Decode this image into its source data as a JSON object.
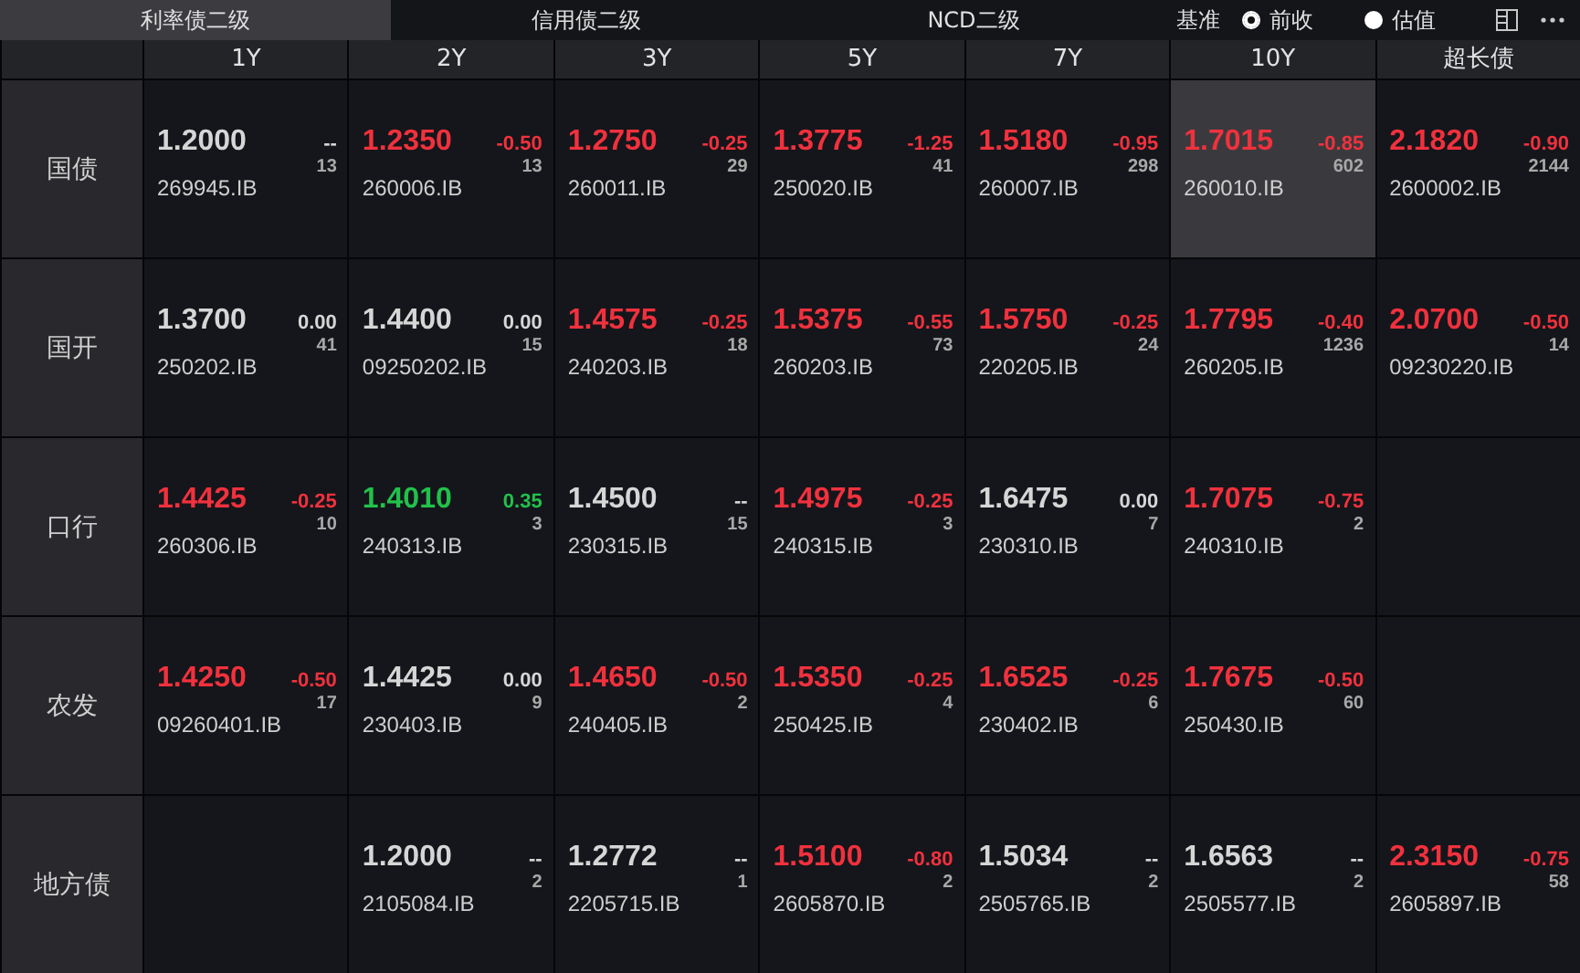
{
  "tabs": [
    {
      "label": "利率债二级",
      "selected": true
    },
    {
      "label": "信用债二级",
      "selected": false
    },
    {
      "label": "NCD二级",
      "selected": false
    }
  ],
  "benchmark": {
    "label": "基准",
    "options": [
      {
        "label": "前收",
        "selected": true
      },
      {
        "label": "估值",
        "selected": false
      }
    ]
  },
  "columns": [
    "1Y",
    "2Y",
    "3Y",
    "5Y",
    "7Y",
    "10Y",
    "超长债"
  ],
  "rows": [
    {
      "name": "国债",
      "cells": [
        {
          "kind": "quote",
          "yield": "1.2000",
          "change": "--",
          "color": "#d6d6d6",
          "count": "13",
          "code": "269945.IB",
          "selected": false
        },
        {
          "kind": "quote",
          "yield": "1.2350",
          "change": "-0.50",
          "color": "#f1313d",
          "count": "13",
          "code": "260006.IB",
          "selected": false
        },
        {
          "kind": "quote",
          "yield": "1.2750",
          "change": "-0.25",
          "color": "#f1313d",
          "count": "29",
          "code": "260011.IB",
          "selected": false
        },
        {
          "kind": "quote",
          "yield": "1.3775",
          "change": "-1.25",
          "color": "#f1313d",
          "count": "41",
          "code": "250020.IB",
          "selected": false
        },
        {
          "kind": "quote",
          "yield": "1.5180",
          "change": "-0.95",
          "color": "#f1313d",
          "count": "298",
          "code": "260007.IB",
          "selected": false
        },
        {
          "kind": "quote",
          "yield": "1.7015",
          "change": "-0.85",
          "color": "#f1313d",
          "count": "602",
          "code": "260010.IB",
          "selected": true
        },
        {
          "kind": "quote",
          "yield": "2.1820",
          "change": "-0.90",
          "color": "#f1313d",
          "count": "2144",
          "code": "2600002.IB",
          "selected": false
        }
      ]
    },
    {
      "name": "国开",
      "cells": [
        {
          "kind": "quote",
          "yield": "1.3700",
          "change": "0.00",
          "color": "#d6d6d6",
          "count": "41",
          "code": "250202.IB",
          "selected": false
        },
        {
          "kind": "quote",
          "yield": "1.4400",
          "change": "0.00",
          "color": "#d6d6d6",
          "count": "15",
          "code": "09250202.IB",
          "selected": false
        },
        {
          "kind": "quote",
          "yield": "1.4575",
          "change": "-0.25",
          "color": "#f1313d",
          "count": "18",
          "code": "240203.IB",
          "selected": false
        },
        {
          "kind": "quote",
          "yield": "1.5375",
          "change": "-0.55",
          "color": "#f1313d",
          "count": "73",
          "code": "260203.IB",
          "selected": false
        },
        {
          "kind": "quote",
          "yield": "1.5750",
          "change": "-0.25",
          "color": "#f1313d",
          "count": "24",
          "code": "220205.IB",
          "selected": false
        },
        {
          "kind": "quote",
          "yield": "1.7795",
          "change": "-0.40",
          "color": "#f1313d",
          "count": "1236",
          "code": "260205.IB",
          "selected": false
        },
        {
          "kind": "quote",
          "yield": "2.0700",
          "change": "-0.50",
          "color": "#f1313d",
          "count": "14",
          "code": "09230220.IB",
          "selected": false
        }
      ]
    },
    {
      "name": "口行",
      "cells": [
        {
          "kind": "quote",
          "yield": "1.4425",
          "change": "-0.25",
          "color": "#f1313d",
          "count": "10",
          "code": "260306.IB",
          "selected": false
        },
        {
          "kind": "quote",
          "yield": "1.4010",
          "change": "0.35",
          "color": "#22c14a",
          "count": "3",
          "code": "240313.IB",
          "selected": false
        },
        {
          "kind": "quote",
          "yield": "1.4500",
          "change": "--",
          "color": "#d6d6d6",
          "count": "15",
          "code": "230315.IB",
          "selected": false
        },
        {
          "kind": "quote",
          "yield": "1.4975",
          "change": "-0.25",
          "color": "#f1313d",
          "count": "3",
          "code": "240315.IB",
          "selected": false
        },
        {
          "kind": "quote",
          "yield": "1.6475",
          "change": "0.00",
          "color": "#d6d6d6",
          "count": "7",
          "code": "230310.IB",
          "selected": false
        },
        {
          "kind": "quote",
          "yield": "1.7075",
          "change": "-0.75",
          "color": "#f1313d",
          "count": "2",
          "code": "240310.IB",
          "selected": false
        },
        {
          "kind": "empty"
        }
      ]
    },
    {
      "name": "农发",
      "cells": [
        {
          "kind": "quote",
          "yield": "1.4250",
          "change": "-0.50",
          "color": "#f1313d",
          "count": "17",
          "code": "09260401.IB",
          "selected": false
        },
        {
          "kind": "quote",
          "yield": "1.4425",
          "change": "0.00",
          "color": "#d6d6d6",
          "count": "9",
          "code": "230403.IB",
          "selected": false
        },
        {
          "kind": "quote",
          "yield": "1.4650",
          "change": "-0.50",
          "color": "#f1313d",
          "count": "2",
          "code": "240405.IB",
          "selected": false
        },
        {
          "kind": "quote",
          "yield": "1.5350",
          "change": "-0.25",
          "color": "#f1313d",
          "count": "4",
          "code": "250425.IB",
          "selected": false
        },
        {
          "kind": "quote",
          "yield": "1.6525",
          "change": "-0.25",
          "color": "#f1313d",
          "count": "6",
          "code": "230402.IB",
          "selected": false
        },
        {
          "kind": "quote",
          "yield": "1.7675",
          "change": "-0.50",
          "color": "#f1313d",
          "count": "60",
          "code": "250430.IB",
          "selected": false
        },
        {
          "kind": "empty"
        }
      ]
    },
    {
      "name": "地方债",
      "cells": [
        {
          "kind": "empty"
        },
        {
          "kind": "quote",
          "yield": "1.2000",
          "change": "--",
          "color": "#d6d6d6",
          "count": "2",
          "code": "2105084.IB",
          "selected": false
        },
        {
          "kind": "quote",
          "yield": "1.2772",
          "change": "--",
          "color": "#d6d6d6",
          "count": "1",
          "code": "2205715.IB",
          "selected": false
        },
        {
          "kind": "quote",
          "yield": "1.5100",
          "change": "-0.80",
          "color": "#f1313d",
          "count": "2",
          "code": "2605870.IB",
          "selected": false
        },
        {
          "kind": "quote",
          "yield": "1.5034",
          "change": "--",
          "color": "#d6d6d6",
          "count": "2",
          "code": "2505765.IB",
          "selected": false
        },
        {
          "kind": "quote",
          "yield": "1.6563",
          "change": "--",
          "color": "#d6d6d6",
          "count": "2",
          "code": "2505577.IB",
          "selected": false
        },
        {
          "kind": "quote",
          "yield": "2.3150",
          "change": "-0.75",
          "color": "#f1313d",
          "count": "58",
          "code": "2605897.IB",
          "selected": false
        }
      ]
    }
  ]
}
